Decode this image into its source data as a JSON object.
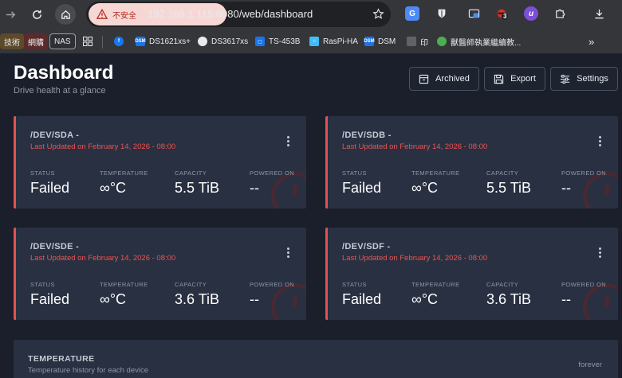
{
  "browser": {
    "security_label": "不安全",
    "url": "192.168.1.115:8080/web/dashboard"
  },
  "extensions": [
    {
      "icon": "translate-icon",
      "color": "#4c8bf5",
      "label": "G"
    },
    {
      "icon": "bitwarden-icon",
      "color": "#e8eaed",
      "label": ""
    },
    {
      "icon": "screen-capture-icon",
      "color": "#8ab4f8",
      "label": ""
    },
    {
      "icon": "ninja-extension-icon",
      "color": "#d93025",
      "label": "",
      "badge": "3"
    },
    {
      "icon": "u-extension-icon",
      "color": "#7b4fd6",
      "label": "u"
    },
    {
      "icon": "puzzle-icon",
      "color": "#e8eaed",
      "label": ""
    },
    {
      "icon": "download-icon",
      "color": "#e8eaed",
      "label": ""
    }
  ],
  "bookmarks": {
    "folders": [
      {
        "label": "技術",
        "color": "#5c4a2a"
      },
      {
        "label": "網購",
        "color": "#5c2a2a"
      },
      {
        "label": "NAS",
        "color": "#2e3035"
      }
    ],
    "items": [
      {
        "label": "",
        "icon": "facebook-icon",
        "color": "#1877f2"
      },
      {
        "label": "DS1621xs+",
        "icon": "dsm-icon",
        "color": "#1a73e8"
      },
      {
        "label": "DS3617xs",
        "icon": "github-icon",
        "color": "#e8eaed"
      },
      {
        "label": "TS-453B",
        "icon": "qnap-icon",
        "color": "#1a73e8"
      },
      {
        "label": "RasPi-HA",
        "icon": "home-assistant-icon",
        "color": "#41bdf5"
      },
      {
        "label": "DSM",
        "icon": "dsm-icon",
        "color": "#1a73e8"
      },
      {
        "label": "印",
        "icon": "document-icon",
        "color": "#9aa0a6"
      },
      {
        "label": "獸醫師執業繼續教...",
        "icon": "leaf-icon",
        "color": "#4caf50"
      }
    ],
    "overflow": "»"
  },
  "header": {
    "title": "Dashboard",
    "subtitle": "Drive health at a glance",
    "archived_label": "Archived",
    "export_label": "Export",
    "settings_label": "Settings"
  },
  "stat_labels": {
    "status": "STATUS",
    "temperature": "TEMPERATURE",
    "capacity": "CAPACITY",
    "powered_on": "POWERED ON"
  },
  "drives": [
    {
      "device": "/DEV/SDA -",
      "updated": "Last Updated on February 14, 2026 - 08:00",
      "status": "Failed",
      "temperature": "∞°C",
      "capacity": "5.5 TiB",
      "powered_on": "--"
    },
    {
      "device": "/DEV/SDB -",
      "updated": "Last Updated on February 14, 2026 - 08:00",
      "status": "Failed",
      "temperature": "∞°C",
      "capacity": "5.5 TiB",
      "powered_on": "--"
    },
    {
      "device": "/DEV/SDE -",
      "updated": "Last Updated on February 14, 2026 - 08:00",
      "status": "Failed",
      "temperature": "∞°C",
      "capacity": "3.6 TiB",
      "powered_on": "--"
    },
    {
      "device": "/DEV/SDF -",
      "updated": "Last Updated on February 14, 2026 - 08:00",
      "status": "Failed",
      "temperature": "∞°C",
      "capacity": "3.6 TiB",
      "powered_on": "--"
    }
  ],
  "temperature_panel": {
    "title": "TEMPERATURE",
    "subtitle": "Temperature history for each device",
    "range": "forever"
  },
  "colors": {
    "failed": "#ef5350",
    "card": "#283041",
    "background": "#1b1f2b"
  }
}
